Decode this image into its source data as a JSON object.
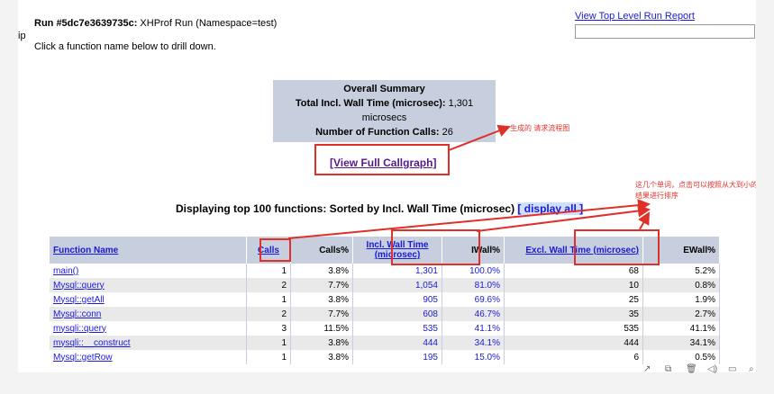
{
  "header": {
    "run_label": "Run #5dc7e3639735c:",
    "run_desc": " XHProf Run (Namespace=test)",
    "ip_text": "ip",
    "top_link": "View Top Level Run Report",
    "drill_text": "Click a function name below to drill down."
  },
  "summary": {
    "title": "Overall Summary",
    "wall_label": "Total Incl. Wall Time (microsec):",
    "wall_value": "1,301 microsecs",
    "calls_label": "Number of Function Calls:",
    "calls_value": "26"
  },
  "callgraph_link": "[View Full Callgraph]",
  "annotations": {
    "callgraph_note": "生成的 请求流程图",
    "sort_note": "这几个单词，点击可以按照从大到小的顺序将结果进行排序"
  },
  "display": {
    "text": "Displaying top 100 functions: Sorted by Incl. Wall Time (microsec)",
    "link": "[ display all ]"
  },
  "table": {
    "columns": [
      "Function Name",
      "Calls",
      "Calls%",
      "Incl. Wall Time (microsec)",
      "IWall%",
      "Excl. Wall Time (microsec)",
      "EWall%"
    ],
    "rows": [
      {
        "fn": "main()",
        "calls": "1",
        "calls_pct": "3.8%",
        "incl": "1,301",
        "iwall": "100.0%",
        "excl": "68",
        "ewall": "5.2%"
      },
      {
        "fn": "Mysql::query",
        "calls": "2",
        "calls_pct": "7.7%",
        "incl": "1,054",
        "iwall": "81.0%",
        "excl": "10",
        "ewall": "0.8%"
      },
      {
        "fn": "Mysql::getAll",
        "calls": "1",
        "calls_pct": "3.8%",
        "incl": "905",
        "iwall": "69.6%",
        "excl": "25",
        "ewall": "1.9%"
      },
      {
        "fn": "Mysql::conn",
        "calls": "2",
        "calls_pct": "7.7%",
        "incl": "608",
        "iwall": "46.7%",
        "excl": "35",
        "ewall": "2.7%"
      },
      {
        "fn": "mysqli::query",
        "calls": "3",
        "calls_pct": "11.5%",
        "incl": "535",
        "iwall": "41.1%",
        "excl": "535",
        "ewall": "41.1%"
      },
      {
        "fn": "mysqli::__construct",
        "calls": "1",
        "calls_pct": "3.8%",
        "incl": "444",
        "iwall": "34.1%",
        "excl": "444",
        "ewall": "34.1%"
      },
      {
        "fn": "Mysql::getRow",
        "calls": "1",
        "calls_pct": "3.8%",
        "incl": "195",
        "iwall": "15.0%",
        "excl": "6",
        "ewall": "0.5%"
      }
    ]
  },
  "toolbar_icons": [
    "share-icon",
    "copy-icon",
    "delete-icon",
    "audio-icon",
    "window-icon",
    "search-icon"
  ],
  "colors": {
    "header_bg": "#c7cedd",
    "link": "#1a1ad8",
    "annotation_red": "#e0302a"
  }
}
